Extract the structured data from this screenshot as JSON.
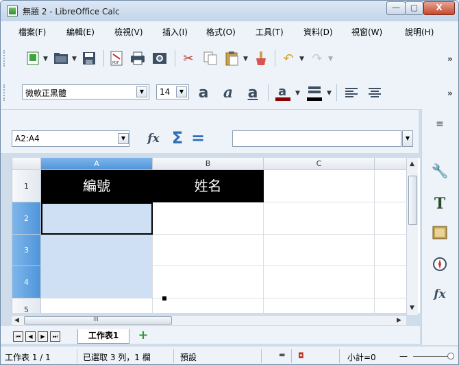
{
  "window": {
    "title": "無題 2 - LibreOffice Calc",
    "minimize_symbol": "—",
    "maximize_symbol": "▢",
    "close_symbol": "X"
  },
  "menubar": {
    "items": [
      "檔案(F)",
      "編輯(E)",
      "檢視(V)",
      "插入(I)",
      "格式(O)",
      "工具(T)",
      "資料(D)",
      "視窗(W)",
      "說明(H)"
    ]
  },
  "toolbar": {
    "more_symbol": "»",
    "font_name": "微軟正黑體",
    "font_size": "14"
  },
  "formula": {
    "name_box_value": "A2:A4",
    "sum_symbol": "Σ",
    "equals_symbol": "="
  },
  "sheet": {
    "columns": [
      "A",
      "B",
      "C"
    ],
    "rows": [
      "1",
      "2",
      "3",
      "4",
      "5"
    ],
    "cells": {
      "A1": "編號",
      "B1": "姓名"
    },
    "selection": "A2:A4",
    "cell_background_row1": "#000000",
    "selection_color": "#cfe0f4"
  },
  "tabs": {
    "nav_first": "⏮",
    "nav_prev": "◀",
    "nav_next": "▶",
    "nav_last": "⏭",
    "sheet_name": "工作表1",
    "add_symbol": "+"
  },
  "statusbar": {
    "sheet_position": "工作表 1 / 1",
    "selection_info": "已選取 3 列，1 欄",
    "page_style": "預設",
    "sum": "小計=0",
    "zoom_minus": "—"
  },
  "scroll": {
    "h_thumb_grip": "III"
  },
  "icons": {
    "app": "libreoffice-calc-icon",
    "sidebar_menu": "sidebar-menu-icon",
    "properties": "wrench-icon",
    "styles": "text-style-icon",
    "gallery": "gallery-icon",
    "navigator": "compass-icon",
    "functions": "function-wizard-icon"
  }
}
